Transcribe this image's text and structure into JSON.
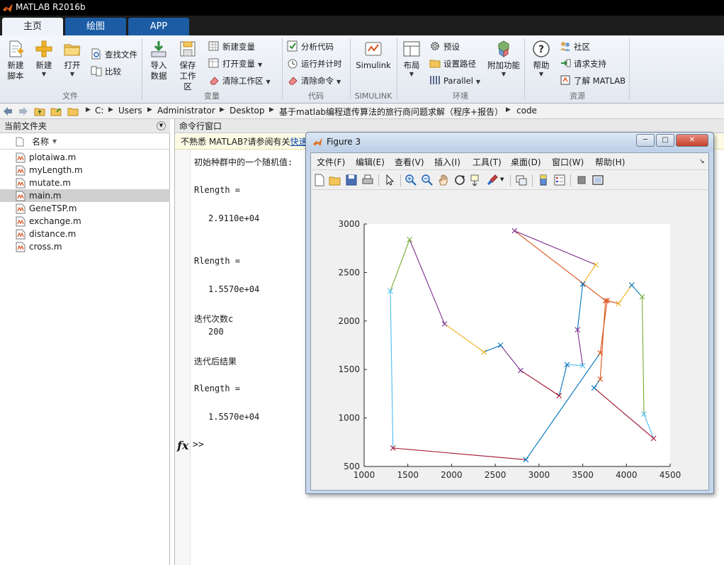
{
  "window": {
    "title": "MATLAB R2016b"
  },
  "ribbon_tabs": [
    "主页",
    "绘图",
    "APP"
  ],
  "ribbon": {
    "file": {
      "label": "文件",
      "new_script": [
        "新建",
        "脚本"
      ],
      "new": "新建",
      "open": "打开",
      "find_files": "查找文件",
      "compare": "比较"
    },
    "variable": {
      "label": "变量",
      "import_data": [
        "导入",
        "数据"
      ],
      "save_workspace": [
        "保存",
        "工作区"
      ],
      "new_variable": "新建变量",
      "open_variable": "打开变量",
      "clear_workspace": "清除工作区"
    },
    "code": {
      "label": "代码",
      "analyze_code": "分析代码",
      "run_and_time": "运行并计时",
      "clear_commands": "清除命令"
    },
    "simulink": {
      "label": "SIMULINK",
      "button": "Simulink"
    },
    "environment": {
      "label": "环境",
      "layout": "布局",
      "preferences": "预设",
      "set_path": "设置路径",
      "parallel": "Parallel",
      "addons": "附加功能"
    },
    "resources": {
      "label": "资源",
      "help": "帮助",
      "community": "社区",
      "request_support": "请求支持",
      "learn_matlab": "了解 MATLAB"
    }
  },
  "address": {
    "breadcrumbs": [
      "C:",
      "Users",
      "Administrator",
      "Desktop",
      "基于matlab编程遗传算法的旅行商问题求解（程序+报告）",
      "code"
    ]
  },
  "current_folder": {
    "title": "当前文件夹",
    "column_header": "名称",
    "files": [
      "plotaiwa.m",
      "myLength.m",
      "mutate.m",
      "main.m",
      "GeneTSP.m",
      "exchange.m",
      "distance.m",
      "cross.m"
    ],
    "selected_file": "main.m"
  },
  "command_window": {
    "title": "命令行窗口",
    "info_text": "不熟悉 MATLAB?请参阅有关",
    "info_link": "快速",
    "lines": [
      "初始种群中的一个随机值:",
      "Rlength =",
      "2.9110e+04",
      "Rlength =",
      "1.5570e+04",
      "迭代次数c",
      "200",
      "迭代后结果",
      "Rlength =",
      "1.5570e+04"
    ],
    "prompt": ">>",
    "fx_label": "fx"
  },
  "figure": {
    "title": "Figure 3",
    "menus": [
      "文件(F)",
      "编辑(E)",
      "查看(V)",
      "插入(I)",
      "工具(T)",
      "桌面(D)",
      "窗口(W)",
      "帮助(H)"
    ],
    "toolbar_icons": [
      "new-figure-icon",
      "open-file-icon",
      "save-icon",
      "print-icon",
      "pointer-icon",
      "zoom-in-icon",
      "zoom-out-icon",
      "pan-icon",
      "rotate-icon",
      "data-cursor-icon",
      "brush-icon",
      "link-icon",
      "colorbar-icon",
      "legend-icon",
      "hide-plot-tools-icon",
      "show-plot-tools-icon"
    ]
  },
  "chart_data": {
    "type": "line",
    "title": "",
    "xlabel": "",
    "ylabel": "",
    "xlim": [
      1000,
      4500
    ],
    "ylim": [
      500,
      3000
    ],
    "xticks": [
      1000,
      1500,
      2000,
      2500,
      3000,
      3500,
      4000,
      4500
    ],
    "yticks": [
      500,
      1000,
      1500,
      2000,
      2500,
      3000
    ],
    "marker": "x",
    "grid": false,
    "x": [
      2720,
      3650,
      3500,
      3440,
      3500,
      3320,
      3230,
      2790,
      2560,
      2370,
      1920,
      1520,
      1300,
      1330,
      2850,
      3700,
      3780,
      3910,
      4060,
      4180,
      4200,
      4310,
      3630,
      3700,
      3760,
      2720
    ],
    "y": [
      2930,
      2580,
      2380,
      1910,
      1540,
      1550,
      1230,
      1490,
      1750,
      1680,
      1970,
      2840,
      2310,
      690,
      570,
      1670,
      2210,
      2180,
      2370,
      2250,
      1040,
      790,
      1310,
      1400,
      2210,
      2930
    ],
    "segment_colors": [
      "#7E2F8E",
      "#EDB120",
      "#0072BD",
      "#7E2F8E",
      "#4DBEEE",
      "#0072BD",
      "#A2142F",
      "#7E2F8E",
      "#0072BD",
      "#EDB120",
      "#7E2F8E",
      "#77AC30",
      "#4DBEEE",
      "#A2142F",
      "#0072BD",
      "#D95319",
      "#D95319",
      "#EDB120",
      "#0072BD",
      "#77AC30",
      "#4DBEEE",
      "#A2142F",
      "#0072BD",
      "#D95319",
      "#D95319"
    ]
  }
}
